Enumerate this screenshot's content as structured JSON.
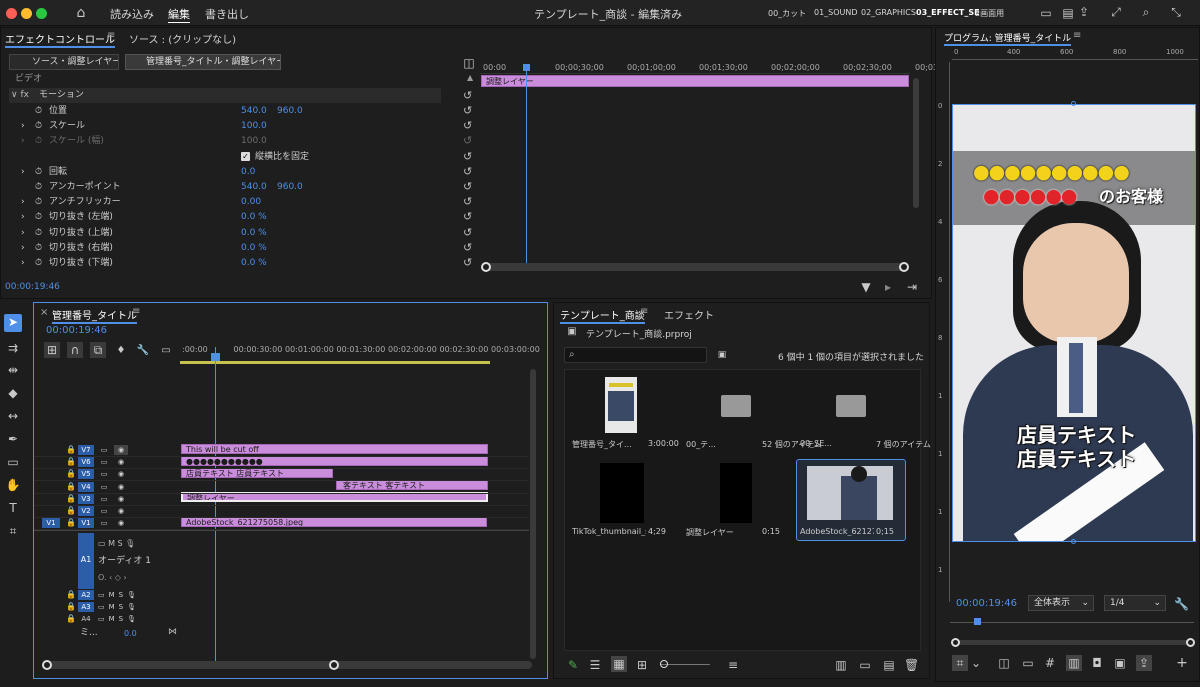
{
  "topbar": {
    "menu": [
      "読み込み",
      "編集",
      "書き出し"
    ],
    "title": "テンプレート_商談 - 編集済み",
    "workspaces": [
      "00_カット",
      "01_SOUND",
      "02_GRAPHICS",
      "03_EFFECT_SE",
      "2画面用"
    ]
  },
  "effects": {
    "tab1": "エフェクトコントロール",
    "tab2": "ソース : (クリップなし)",
    "src_master": "ソース・調整レイヤー",
    "src_clip": "管理番号_タイトル・調整レイヤー...",
    "section": "ビデオ",
    "motion": "モーション",
    "rows": [
      {
        "label": "位置",
        "v1": "540.0",
        "v2": "960.0"
      },
      {
        "label": "スケール",
        "v1": "100.0",
        "v2": ""
      },
      {
        "label": "スケール (幅)",
        "v1": "100.0",
        "v2": ""
      },
      {
        "label": "縦横比を固定",
        "v1": "",
        "v2": ""
      },
      {
        "label": "回転",
        "v1": "0.0",
        "v2": ""
      },
      {
        "label": "アンカーポイント",
        "v1": "540.0",
        "v2": "960.0"
      },
      {
        "label": "アンチフリッカー",
        "v1": "0.00",
        "v2": ""
      },
      {
        "label": "切り抜き (左端)",
        "v1": "0.0 %",
        "v2": ""
      },
      {
        "label": "切り抜き (上端)",
        "v1": "0.0 %",
        "v2": ""
      },
      {
        "label": "切り抜き (右端)",
        "v1": "0.0 %",
        "v2": ""
      },
      {
        "label": "切り抜き (下端)",
        "v1": "0.0 %",
        "v2": ""
      }
    ],
    "ruler": [
      "00:00",
      "00;00;30;00",
      "00;01;00;00",
      "00;01;30;00",
      "00;02;00;00",
      "00;02;30;00",
      "00;03"
    ],
    "clip": "調整レイヤー",
    "timecode": "00:00:19:46"
  },
  "timeline": {
    "title": "管理番号_タイトル",
    "timecode": "00:00:19:46",
    "ruler": [
      ":00:00",
      "00:00:30:00",
      "00:01:00:00",
      "00:01:30:00",
      "00:02:00:00",
      "00:02:30:00",
      "00:03:00:00"
    ],
    "vtracks": [
      "V7",
      "V6",
      "V5",
      "V4",
      "V3",
      "V2",
      "V1"
    ],
    "source_v": "V1",
    "clips": {
      "v7": "This will be cut off",
      "v6": "●●●●●●●●●●●",
      "v5": "店員テキスト 店員テキスト",
      "v4": "客テキスト 客テキスト",
      "v3": "調整レイヤー",
      "v1": "AdobeStock_621275058.jpeg"
    },
    "atracks": [
      "A1",
      "A2",
      "A3",
      "A4"
    ],
    "audio1": "オーディオ 1",
    "mix": "ミ...",
    "mix_val": "0.0"
  },
  "project": {
    "tab1": "テンプレート_商談",
    "tab2": "エフェクト",
    "file": "テンプレート_商談.prproj",
    "count": "6 個中 1 個の項目が選択されました",
    "items": [
      {
        "name": "管理番号_タイ...",
        "meta": "3:00:00"
      },
      {
        "name": "00_テ...",
        "meta": "52 個のアイテム"
      },
      {
        "name": "00_SE...",
        "meta": "7 個のアイテム"
      },
      {
        "name": "TikTok_thumbnail_si...",
        "meta": "4;29"
      },
      {
        "name": "調整レイヤー",
        "meta": "0:15"
      },
      {
        "name": "AdobeStock_621275...",
        "meta": "0;15"
      }
    ]
  },
  "program": {
    "title": "プログラム: 管理番号_タイトル",
    "ruler": [
      "0",
      "400",
      "600",
      "800",
      "1000"
    ],
    "vruler": [
      "0",
      "2",
      "4",
      "6",
      "8",
      "1",
      "1",
      "1",
      "1"
    ],
    "caption_top": "●●●●●●●●●●",
    "caption_sub_dots": "●●●●●●",
    "caption_sub_text": "のお客様",
    "caption_bottom": "店員テキスト",
    "timecode": "00:00:19:46",
    "zoom": "全体表示",
    "res": "1/4"
  }
}
